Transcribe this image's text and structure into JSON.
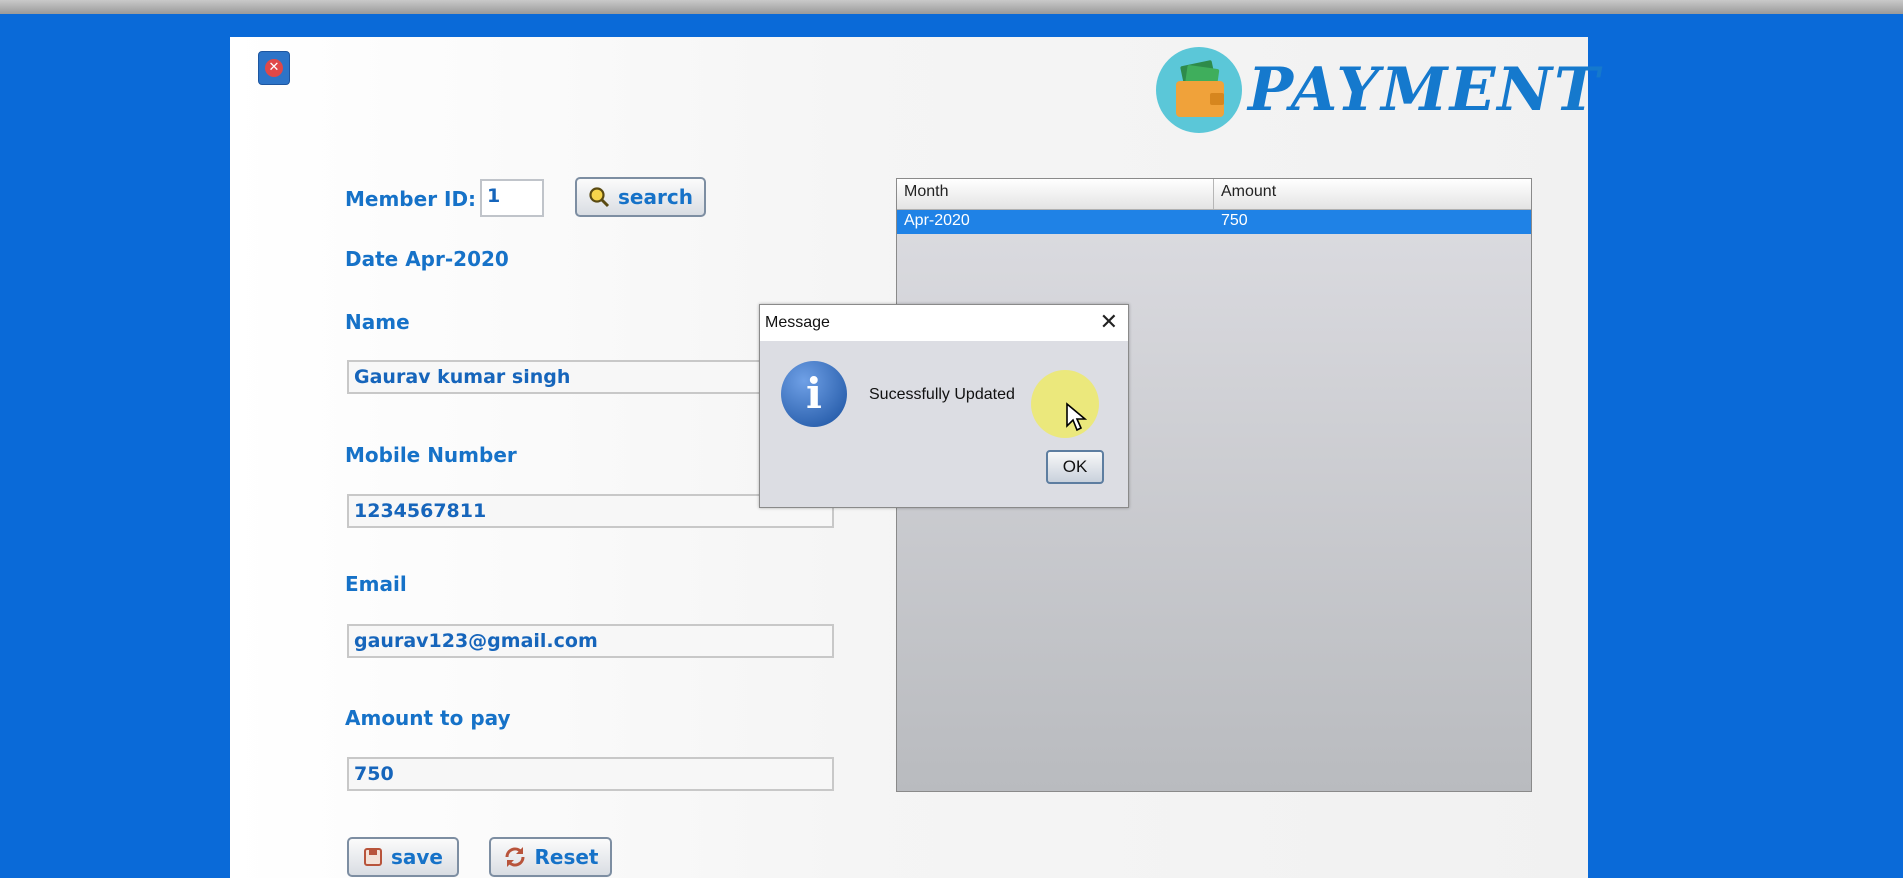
{
  "header": {
    "close_icon": "close-icon",
    "logo_icon": "wallet-money-icon",
    "logo_text": "PAYMENT"
  },
  "form": {
    "member_id_label": "Member ID:",
    "member_id_value": "1",
    "search_label": "search",
    "date_label": "Date",
    "date_value": "Apr-2020",
    "name_label": "Name",
    "name_value": "Gaurav kumar singh",
    "mobile_label": "Mobile Number",
    "mobile_value": "1234567811",
    "email_label": "Email",
    "email_value": "gaurav123@gmail.com",
    "amount_label": "Amount to pay",
    "amount_value": "750",
    "save_label": "save",
    "reset_label": "Reset"
  },
  "table": {
    "columns": [
      "Month",
      "Amount"
    ],
    "rows": [
      {
        "month": "Apr-2020",
        "amount": "750",
        "selected": true
      }
    ]
  },
  "dialog": {
    "title": "Message",
    "message": "Sucessfully Updated",
    "ok_label": "OK",
    "icon": "info-icon"
  },
  "colors": {
    "background": "#0a6ad8",
    "label": "#1672c8",
    "selection": "#1f82e6"
  }
}
